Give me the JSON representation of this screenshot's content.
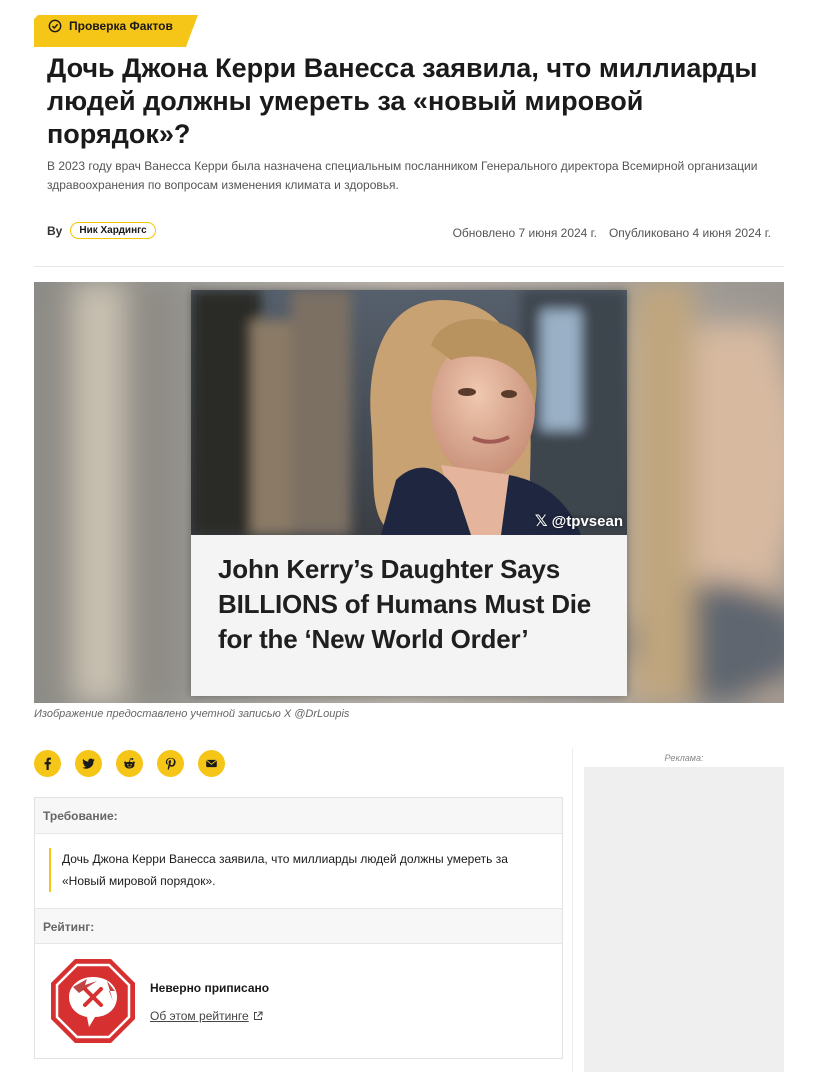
{
  "badge": {
    "label": "Проверка Фактов",
    "icon": "check-circle-icon",
    "color": "#f5c518"
  },
  "article": {
    "title": "Дочь Джона Керри Ванесса заявила, что миллиарды людей должны умереть за «новый мировой порядок»?",
    "subtitle": "В 2023 году врач Ванесса Керри была назначена специальным посланником Генерального директора Всемирной организации здравоохранения по вопросам изменения климата и здоровья."
  },
  "byline": {
    "by": "By",
    "author": "Ник Хардингс",
    "updated": "Обновлено 7 июня 2024 г.",
    "published": "Опубликовано 4 июня 2024 г."
  },
  "hero": {
    "handle": "@tpvsean",
    "headline": "John Kerry’s Daughter Says BILLIONS of Humans Must Die for the ‘New World Order’",
    "caption": "Изображение предоставлено учетной записью X @DrLoupis"
  },
  "share": {
    "buttons": [
      {
        "name": "facebook-icon"
      },
      {
        "name": "twitter-icon"
      },
      {
        "name": "reddit-icon"
      },
      {
        "name": "pinterest-icon"
      },
      {
        "name": "email-icon"
      }
    ],
    "accent": "#f5c518"
  },
  "ad": {
    "label": "Реклама:"
  },
  "claim": {
    "heading": "Требование:",
    "text": "Дочь Джона Керри Ванесса заявила, что миллиарды людей должны умереть за «Новый мировой порядок»."
  },
  "rating": {
    "heading": "Рейтинг:",
    "value": "Неверно приписано",
    "link": "Об этом рейтинге",
    "icon": "misattributed-stop-icon",
    "color": "#d63031"
  }
}
